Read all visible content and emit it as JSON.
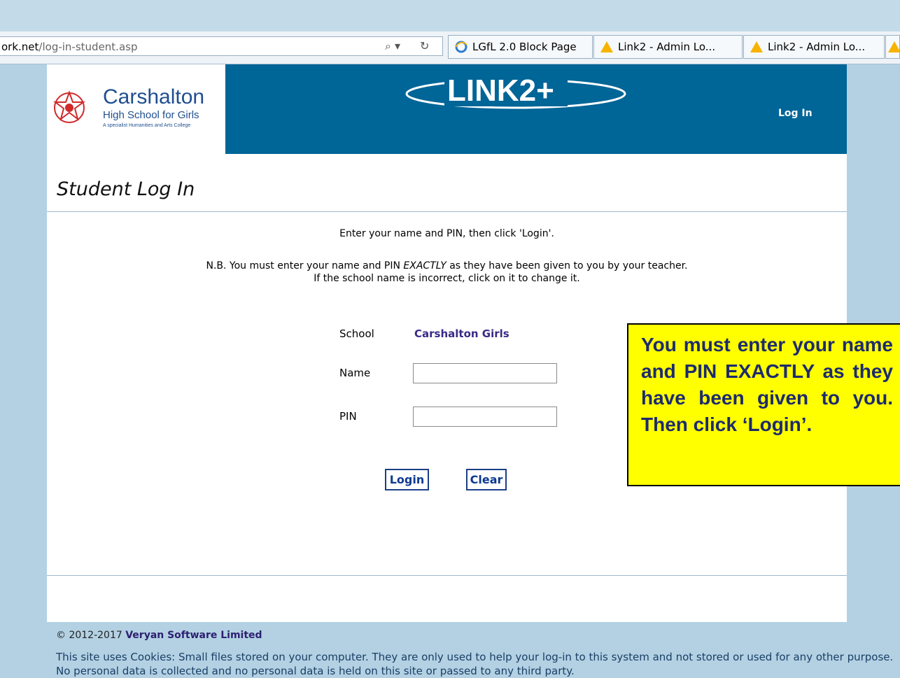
{
  "browser": {
    "url_domain_fragment": "ork.net",
    "url_path": "/log-in-student.asp",
    "tabs": [
      {
        "label": "LGfL 2.0 Block Page"
      },
      {
        "label": "Link2 - Admin Lo..."
      },
      {
        "label": "Link2 - Admin Lo..."
      }
    ]
  },
  "header": {
    "school_name": "Carshalton",
    "school_subtitle": "High School for Girls",
    "school_tagline": "A specialist Humanities and Arts College",
    "product_logo": "LINK2+",
    "nav_login": "Log In"
  },
  "page": {
    "title": "Student Log In",
    "instruction": "Enter your name and PIN, then click 'Login'.",
    "nb_prefix": "N.B. You must enter your name and PIN ",
    "nb_emph": "EXACTLY",
    "nb_suffix": " as they have been given to you by your teacher.",
    "school_hint": "If the school name is incorrect, click on it to change it."
  },
  "form": {
    "school_label": "School",
    "school_value": "Carshalton Girls",
    "name_label": "Name",
    "name_value": "",
    "pin_label": "PIN",
    "pin_value": "",
    "login_button": "Login",
    "clear_button": "Clear"
  },
  "callout": {
    "text": "You must enter your name and PIN EXACTLY as they have been given to you. Then click ‘Login’."
  },
  "footer": {
    "copyright_prefix": "© 2012-2017 ",
    "company": "Veryan Software Limited",
    "cookie_text": "This site uses Cookies: Small files stored on your computer. They are only used to help your log-in to this system and not stored or used for any other purpose. No personal data is collected and no personal data is held on this site or passed to any third party."
  },
  "colors": {
    "header_band": "#006597",
    "callout_bg": "#ffff00",
    "page_bg": "#b3d1e3"
  }
}
